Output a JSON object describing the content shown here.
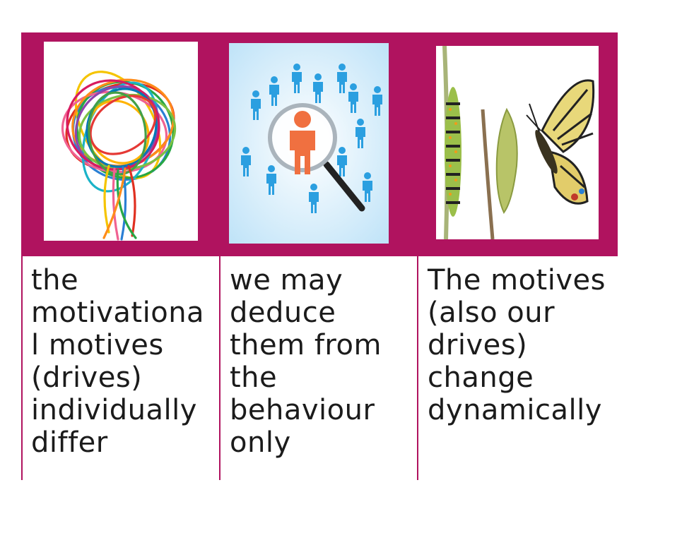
{
  "cards": [
    {
      "image": "tangled-rubber-bands-image",
      "caption": "the\nmotivationa\nl motives\n(drives)\nindividually\ndiffer"
    },
    {
      "image": "magnifying-glass-people-image",
      "caption": "we may\ndeduce\nthem from\nthe\nbehaviour\nonly"
    },
    {
      "image": "caterpillar-chrysalis-butterfly-image",
      "caption": "The motives\n(also our\ndrives)\nchange\ndynamically"
    }
  ],
  "colors": {
    "accent": "#b0135f",
    "person_blue": "#2b9fe0",
    "person_orange": "#f07040"
  }
}
